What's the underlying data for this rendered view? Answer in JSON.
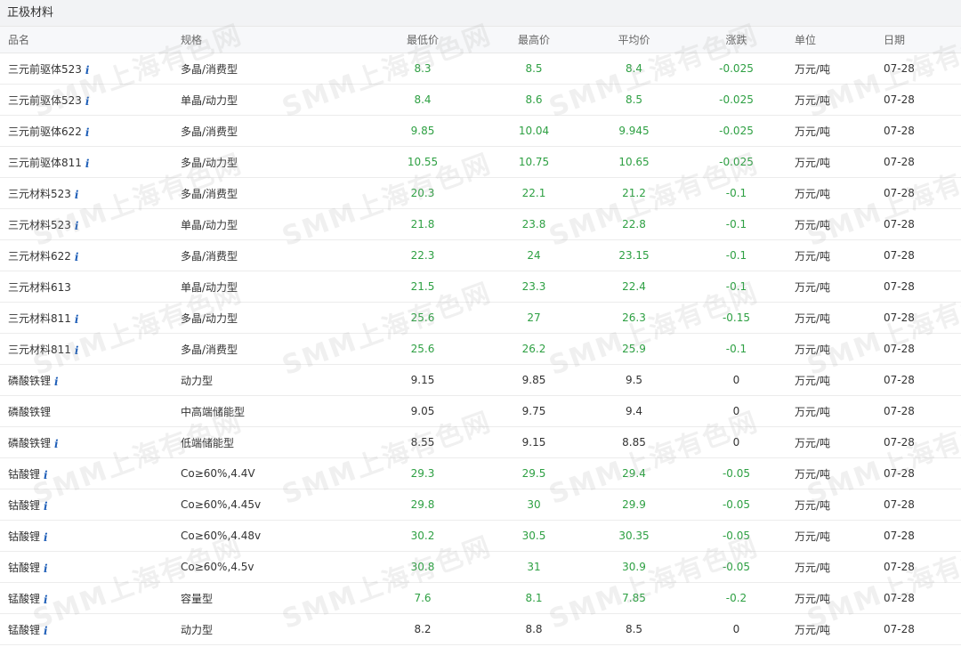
{
  "section_title": "正极材料",
  "headers": {
    "name": "品名",
    "spec": "规格",
    "low": "最低价",
    "high": "最高价",
    "avg": "平均价",
    "change": "涨跌",
    "unit": "单位",
    "date": "日期"
  },
  "info_icon": "i",
  "watermark_text": "SMM上海有色网",
  "rows": [
    {
      "name": "三元前驱体523",
      "info": true,
      "spec": "多晶/消费型",
      "low": "8.3",
      "high": "8.5",
      "avg": "8.4",
      "change": "-0.025",
      "unit": "万元/吨",
      "date": "07-28",
      "trend": "down"
    },
    {
      "name": "三元前驱体523",
      "info": true,
      "spec": "单晶/动力型",
      "low": "8.4",
      "high": "8.6",
      "avg": "8.5",
      "change": "-0.025",
      "unit": "万元/吨",
      "date": "07-28",
      "trend": "down"
    },
    {
      "name": "三元前驱体622",
      "info": true,
      "spec": "多晶/消费型",
      "low": "9.85",
      "high": "10.04",
      "avg": "9.945",
      "change": "-0.025",
      "unit": "万元/吨",
      "date": "07-28",
      "trend": "down"
    },
    {
      "name": "三元前驱体811",
      "info": true,
      "spec": "多晶/动力型",
      "low": "10.55",
      "high": "10.75",
      "avg": "10.65",
      "change": "-0.025",
      "unit": "万元/吨",
      "date": "07-28",
      "trend": "down"
    },
    {
      "name": "三元材料523",
      "info": true,
      "spec": "多晶/消费型",
      "low": "20.3",
      "high": "22.1",
      "avg": "21.2",
      "change": "-0.1",
      "unit": "万元/吨",
      "date": "07-28",
      "trend": "down"
    },
    {
      "name": "三元材料523",
      "info": true,
      "spec": "单晶/动力型",
      "low": "21.8",
      "high": "23.8",
      "avg": "22.8",
      "change": "-0.1",
      "unit": "万元/吨",
      "date": "07-28",
      "trend": "down"
    },
    {
      "name": "三元材料622",
      "info": true,
      "spec": "多晶/消费型",
      "low": "22.3",
      "high": "24",
      "avg": "23.15",
      "change": "-0.1",
      "unit": "万元/吨",
      "date": "07-28",
      "trend": "down"
    },
    {
      "name": "三元材料613",
      "info": false,
      "spec": "单晶/动力型",
      "low": "21.5",
      "high": "23.3",
      "avg": "22.4",
      "change": "-0.1",
      "unit": "万元/吨",
      "date": "07-28",
      "trend": "down"
    },
    {
      "name": "三元材料811",
      "info": true,
      "spec": "多晶/动力型",
      "low": "25.6",
      "high": "27",
      "avg": "26.3",
      "change": "-0.15",
      "unit": "万元/吨",
      "date": "07-28",
      "trend": "down"
    },
    {
      "name": "三元材料811",
      "info": true,
      "spec": "多晶/消费型",
      "low": "25.6",
      "high": "26.2",
      "avg": "25.9",
      "change": "-0.1",
      "unit": "万元/吨",
      "date": "07-28",
      "trend": "down"
    },
    {
      "name": "磷酸铁锂",
      "info": true,
      "spec": "动力型",
      "low": "9.15",
      "high": "9.85",
      "avg": "9.5",
      "change": "0",
      "unit": "万元/吨",
      "date": "07-28",
      "trend": "flat"
    },
    {
      "name": "磷酸铁锂",
      "info": false,
      "spec": "中高端储能型",
      "low": "9.05",
      "high": "9.75",
      "avg": "9.4",
      "change": "0",
      "unit": "万元/吨",
      "date": "07-28",
      "trend": "flat"
    },
    {
      "name": "磷酸铁锂",
      "info": true,
      "spec": "低端储能型",
      "low": "8.55",
      "high": "9.15",
      "avg": "8.85",
      "change": "0",
      "unit": "万元/吨",
      "date": "07-28",
      "trend": "flat"
    },
    {
      "name": "钴酸锂",
      "info": true,
      "spec": "Co≥60%,4.4V",
      "low": "29.3",
      "high": "29.5",
      "avg": "29.4",
      "change": "-0.05",
      "unit": "万元/吨",
      "date": "07-28",
      "trend": "down"
    },
    {
      "name": "钴酸锂",
      "info": true,
      "spec": "Co≥60%,4.45v",
      "low": "29.8",
      "high": "30",
      "avg": "29.9",
      "change": "-0.05",
      "unit": "万元/吨",
      "date": "07-28",
      "trend": "down"
    },
    {
      "name": "钴酸锂",
      "info": true,
      "spec": "Co≥60%,4.48v",
      "low": "30.2",
      "high": "30.5",
      "avg": "30.35",
      "change": "-0.05",
      "unit": "万元/吨",
      "date": "07-28",
      "trend": "down"
    },
    {
      "name": "钴酸锂",
      "info": true,
      "spec": "Co≥60%,4.5v",
      "low": "30.8",
      "high": "31",
      "avg": "30.9",
      "change": "-0.05",
      "unit": "万元/吨",
      "date": "07-28",
      "trend": "down"
    },
    {
      "name": "锰酸锂",
      "info": true,
      "spec": "容量型",
      "low": "7.6",
      "high": "8.1",
      "avg": "7.85",
      "change": "-0.2",
      "unit": "万元/吨",
      "date": "07-28",
      "trend": "down"
    },
    {
      "name": "锰酸锂",
      "info": true,
      "spec": "动力型",
      "low": "8.2",
      "high": "8.8",
      "avg": "8.5",
      "change": "0",
      "unit": "万元/吨",
      "date": "07-28",
      "trend": "flat"
    }
  ],
  "colors": {
    "down": "#2ea043",
    "flat": "#333333",
    "info": "#1f5fb8",
    "header_bg": "#f2f3f5"
  }
}
